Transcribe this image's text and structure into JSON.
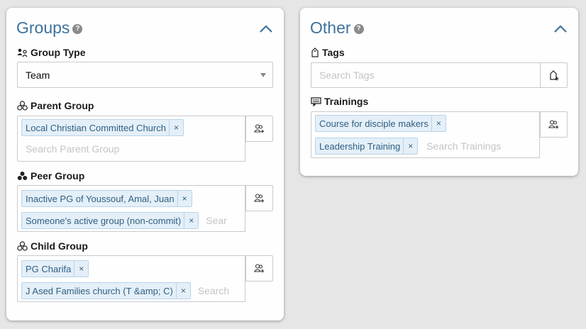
{
  "groups_panel": {
    "title": "Groups",
    "help_glyph": "?",
    "group_type": {
      "label": "Group Type",
      "value": "Team"
    },
    "parent_group": {
      "label": "Parent Group",
      "chips": [
        "Local Christian Committed Church"
      ],
      "placeholder": "Search Parent Group"
    },
    "peer_group": {
      "label": "Peer Group",
      "chips": [
        "Inactive PG of Youssouf, Amal, Juan",
        "Someone's active group (non-commit)"
      ],
      "placeholder": "Sear"
    },
    "child_group": {
      "label": "Child Group",
      "chips": [
        "PG Charifa",
        "J Ased Families church (T &amp; C)"
      ],
      "placeholder": "Search"
    }
  },
  "other_panel": {
    "title": "Other",
    "help_glyph": "?",
    "tags": {
      "label": "Tags",
      "placeholder": "Search Tags"
    },
    "trainings": {
      "label": "Trainings",
      "chips": [
        "Course for disciple makers",
        "Leadership Training"
      ],
      "placeholder": "Search Trainings"
    }
  },
  "chip_remove_glyph": "×",
  "icons": {
    "collapse": "chevron-up-icon",
    "group_type": "group-type-icon",
    "connection": "connection-group-icon",
    "tag": "tag-icon",
    "training": "training-icon",
    "add_group": "add-group-icon",
    "add_tag": "add-tag-icon"
  },
  "colors": {
    "title": "#3f729b",
    "chip_bg": "#e4eff8",
    "chip_border": "#b8d4ea",
    "chip_text": "#2f5f82",
    "placeholder": "#c4c4c4",
    "page_bg": "#e6e6e6"
  }
}
